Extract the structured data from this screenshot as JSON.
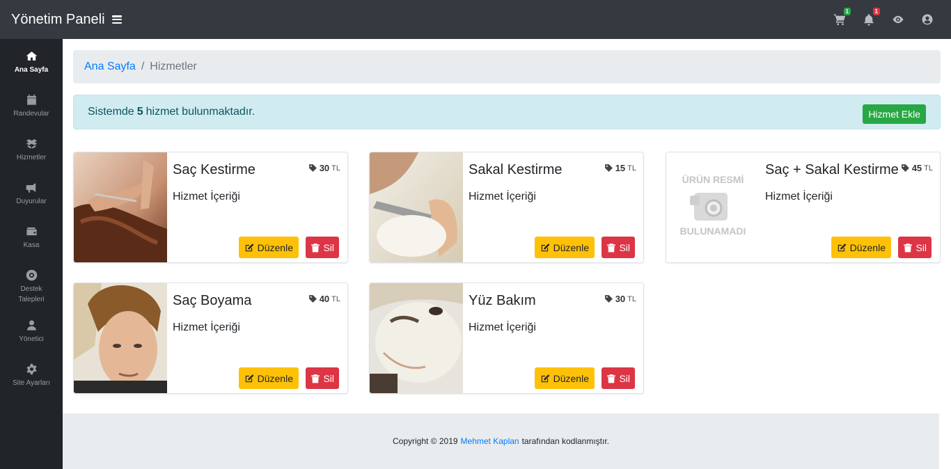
{
  "header": {
    "title": "Yönetim Paneli",
    "cart_badge": "1",
    "notification_badge": "1",
    "colors": {
      "bar": "#343a40",
      "cart_badge": "#28a745",
      "notification_badge": "#dc3545"
    }
  },
  "sidebar": {
    "items": [
      {
        "label": "Ana Sayfa",
        "icon": "home-icon",
        "active": true
      },
      {
        "label": "Randevular",
        "icon": "calendar-icon",
        "active": false
      },
      {
        "label": "Hizmetler",
        "icon": "boxes-icon",
        "active": false
      },
      {
        "label": "Duyurular",
        "icon": "megaphone-icon",
        "active": false
      },
      {
        "label": "Kasa",
        "icon": "wallet-icon",
        "active": false
      },
      {
        "label": "Destek Talepleri",
        "icon": "life-ring-icon",
        "active": false
      },
      {
        "label": "Yönetici",
        "icon": "user-icon",
        "active": false
      },
      {
        "label": "Site Ayarları",
        "icon": "cog-icon",
        "active": false
      }
    ]
  },
  "breadcrumb": {
    "home": "Ana Sayfa",
    "separator": "/",
    "current": "Hizmetler"
  },
  "alert": {
    "prefix": "Sistemde",
    "count": "5",
    "suffix": "hizmet bulunmaktadır.",
    "add_button": "Hizmet Ekle"
  },
  "services": [
    {
      "title": "Saç Kestirme",
      "price": "30",
      "currency": "TL",
      "description": "Hizmet İçeriği",
      "image": "haircut-photo"
    },
    {
      "title": "Sakal Kestirme",
      "price": "15",
      "currency": "TL",
      "description": "Hizmet İçeriği",
      "image": "shave-photo"
    },
    {
      "title": "Saç + Sakal Kestirme",
      "price": "45",
      "currency": "TL",
      "description": "Hizmet İçeriği",
      "image": "no-image-placeholder",
      "placeholder_top": "ÜRÜN RESMİ",
      "placeholder_bottom": "BULUNAMADI"
    },
    {
      "title": "Saç Boyama",
      "price": "40",
      "currency": "TL",
      "description": "Hizmet İçeriği",
      "image": "hair-color-photo"
    },
    {
      "title": "Yüz Bakım",
      "price": "30",
      "currency": "TL",
      "description": "Hizmet İçeriği",
      "image": "face-mask-photo"
    }
  ],
  "buttons": {
    "edit": "Düzenle",
    "delete": "Sil"
  },
  "footer": {
    "prefix": "Copyright © 2019",
    "author": "Mehmet Kaplan",
    "suffix": "tarafından kodlanmıştır."
  }
}
